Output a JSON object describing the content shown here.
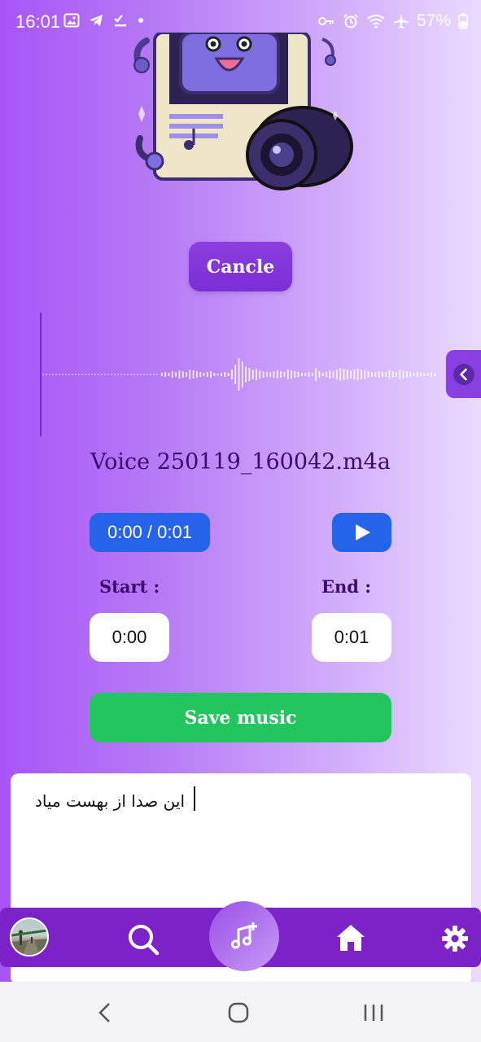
{
  "status_bar": {
    "time": "16:01",
    "battery": "57%",
    "left_icons": [
      "gallery-icon",
      "telegram-icon",
      "checklist-icon",
      "dot-icon"
    ],
    "right_icons": [
      "key-icon",
      "alarm-icon",
      "wifi-icon",
      "airplane-icon",
      "battery-icon"
    ]
  },
  "cancel_label": "Cancle",
  "file_name": "Voice 250119_160042.m4a",
  "player": {
    "time_display": "0:00 / 0:01",
    "play_icon": "play-icon"
  },
  "trim": {
    "start_label": "Start :",
    "start_value": "0:00",
    "end_label": "End :",
    "end_value": "0:01"
  },
  "save_label": "Save music",
  "text_input": {
    "value": "این صدا از بهست میاد"
  },
  "bottom_nav": {
    "items": [
      "avatar",
      "search-icon",
      "music-add-icon",
      "home-icon",
      "gear-icon"
    ]
  },
  "colors": {
    "accent": "#7b22c8",
    "blue": "#2563eb",
    "green": "#22c55e",
    "text_dark": "#3b0a6b"
  }
}
